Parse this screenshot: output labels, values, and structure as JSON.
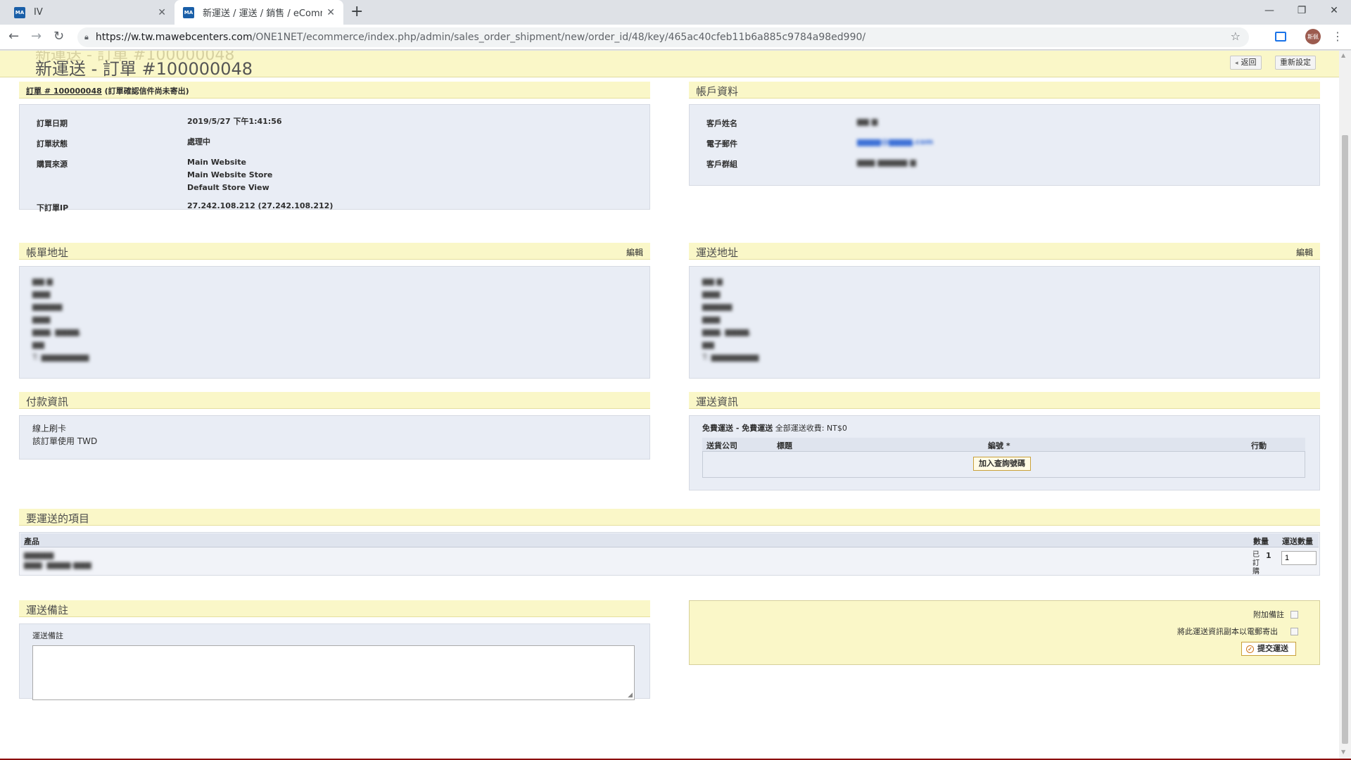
{
  "browser": {
    "tabs": [
      {
        "title": "IV",
        "favicon": "MA"
      },
      {
        "title": "新運送 / 運送 / 銷售 / eCommer",
        "favicon": "MA"
      }
    ],
    "url_prefix": "https://w.tw.mawebcenters.com",
    "url_path": "/ONE1NET/ecommerce/index.php/admin/sales_order_shipment/new/order_id/48/key/465ac40cfeb11b6a885c9784a98ed990/",
    "avatar_text": "斯佩",
    "icons": {
      "back": "arrow-left-icon",
      "forward": "arrow-right-icon",
      "reload": "reload-icon",
      "lock": "lock-icon",
      "bookmark": "star-icon",
      "menu": "menu-dots-icon"
    }
  },
  "header": {
    "title": "新運送 - 訂單 #100000048",
    "ghost_title": "新運送 - 訂單 #100000048",
    "back_label": "返回",
    "reset_label": "重新設定"
  },
  "order_section": {
    "link_text": "訂單 # 100000048",
    "note": "(訂單確認信件尚未寄出)",
    "rows": [
      {
        "label": "訂單日期",
        "value": "2019/5/27 下午1:41:56"
      },
      {
        "label": "訂單狀態",
        "value": "處理中"
      },
      {
        "label": "購買來源",
        "value": [
          "Main Website",
          "Main Website Store",
          "Default Store View"
        ]
      },
      {
        "label": "下訂單IP",
        "value": "27.242.108.212 (27.242.108.212)"
      }
    ]
  },
  "account_section": {
    "title": "帳戶資料",
    "rows": [
      {
        "label": "客戶姓名",
        "value": "▆▆ ▆"
      },
      {
        "label": "電子郵件",
        "value": "▆▆▆▆@▆▆▆▆.com"
      },
      {
        "label": "客戶群組",
        "value": "▆▆▆ ▆▆▆▆▆ ▆"
      }
    ]
  },
  "billing_section": {
    "title": "帳單地址",
    "edit_label": "編輯",
    "lines": [
      "▆▆ ▆",
      "▆▆▆",
      "▆▆▆▆▆",
      "▆▆▆",
      "▆▆▆, ▆▆▆▆,",
      "▆▆",
      "T: ▆▆▆▆▆▆▆▆"
    ]
  },
  "shipping_address_section": {
    "title": "運送地址",
    "edit_label": "編輯",
    "lines": [
      "▆▆ ▆",
      "▆▆▆",
      "▆▆▆▆▆",
      "▆▆▆",
      "▆▆▆, ▆▆▆▆,",
      "▆▆",
      "T: ▆▆▆▆▆▆▆▆"
    ]
  },
  "payment_section": {
    "title": "付款資訊",
    "method": "線上刷卡",
    "currency_note": "該訂單使用 TWD"
  },
  "shipping_info_section": {
    "title": "運送資訊",
    "method_bold": "免費運送 - 免費運送",
    "method_rest": "全部運送收費: NT$0",
    "columns": [
      "送貨公司",
      "標題",
      "編號 *",
      "行動"
    ],
    "add_tracking_label": "加入查詢號碼"
  },
  "items_section": {
    "title": "要運送的項目",
    "columns": {
      "product": "產品",
      "qty": "數量",
      "ship_qty": "運送數量"
    },
    "items": [
      {
        "name": "▆▆▆▆▆",
        "sku": "▆▆▆: ▆▆▆▆-▆▆▆",
        "ordered_label": "已訂購",
        "ordered_qty": "1",
        "ship_qty": "1"
      }
    ]
  },
  "notes_section": {
    "title": "運送備註",
    "field_label": "運送備註",
    "value": ""
  },
  "submit_section": {
    "append_comments_label": "附加備註",
    "email_copy_label": "將此運送資訊副本以電郵寄出",
    "submit_label": "提交運送"
  }
}
